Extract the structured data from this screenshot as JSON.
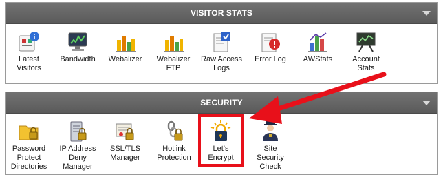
{
  "visitor_stats": {
    "title": "VISITOR STATS",
    "items": [
      {
        "label": "Latest\nVisitors",
        "icon": "latest-visitors-icon"
      },
      {
        "label": "Bandwidth",
        "icon": "bandwidth-icon"
      },
      {
        "label": "Webalizer",
        "icon": "webalizer-icon"
      },
      {
        "label": "Webalizer\nFTP",
        "icon": "webalizer-ftp-icon"
      },
      {
        "label": "Raw Access\nLogs",
        "icon": "raw-access-logs-icon"
      },
      {
        "label": "Error Log",
        "icon": "error-log-icon"
      },
      {
        "label": "AWStats",
        "icon": "awstats-icon"
      },
      {
        "label": "Account\nStats",
        "icon": "account-stats-icon"
      }
    ]
  },
  "security": {
    "title": "SECURITY",
    "items": [
      {
        "label": "Password\nProtect\nDirectories",
        "icon": "folder-lock-icon"
      },
      {
        "label": "IP Address\nDeny\nManager",
        "icon": "server-lock-icon"
      },
      {
        "label": "SSL/TLS\nManager",
        "icon": "certificate-lock-icon"
      },
      {
        "label": "Hotlink\nProtection",
        "icon": "chain-lock-icon"
      },
      {
        "label": "Let's\nEncrypt",
        "icon": "lets-encrypt-icon"
      },
      {
        "label": "Site\nSecurity\nCheck",
        "icon": "security-guard-icon"
      }
    ]
  },
  "colors": {
    "header": "#636363",
    "highlight": "#e8101a",
    "arrow": "#e8101a"
  }
}
